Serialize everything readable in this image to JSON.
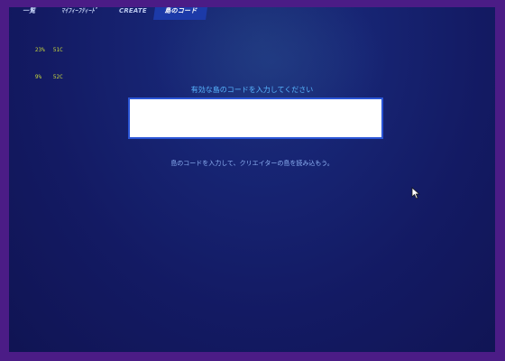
{
  "tabs": [
    {
      "label": "一覧",
      "active": false
    },
    {
      "label": "ﾏｲﾌｨｰﾌﾃｨｰﾄﾞ",
      "active": false
    },
    {
      "label": "CREATE",
      "active": false
    },
    {
      "label": "島のコード",
      "active": true
    }
  ],
  "stats": [
    {
      "a": "23%",
      "b": "51C"
    },
    {
      "a": "9%",
      "b": "52C"
    }
  ],
  "island_code": {
    "prompt": "有効な島のコードを入力してください",
    "value": "",
    "placeholder": "",
    "helper": "島のコードを入力して、クリエイターの島を読み込もう。"
  },
  "colors": {
    "outer_frame": "#4b1c86",
    "background": "#131a63",
    "accent_blue": "#58b6ff",
    "active_tab": "#1c3aa8",
    "stats_text": "#c9d93a"
  },
  "icons": {
    "cursor": "mouse-pointer-icon"
  }
}
